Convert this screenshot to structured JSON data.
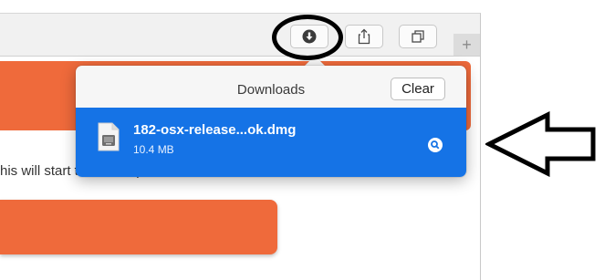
{
  "toolbar": {
    "buttons": [
      {
        "name": "downloads-button",
        "icon": "download-circle-icon"
      },
      {
        "name": "share-button",
        "icon": "share-icon"
      },
      {
        "name": "tabs-overview-button",
        "icon": "tabs-icon"
      }
    ],
    "new_tab_label": "+"
  },
  "page": {
    "body_text": "his will start the install process..."
  },
  "downloads_popover": {
    "title": "Downloads",
    "clear_label": "Clear",
    "items": [
      {
        "file_name": "182-osx-release...ok.dmg",
        "size": "10.4 MB",
        "icon": "dmg-file-icon",
        "action_icon": "magnifier-icon"
      }
    ]
  },
  "colors": {
    "accent_orange": "#ef6a3b",
    "selection_blue": "#1573e6"
  }
}
